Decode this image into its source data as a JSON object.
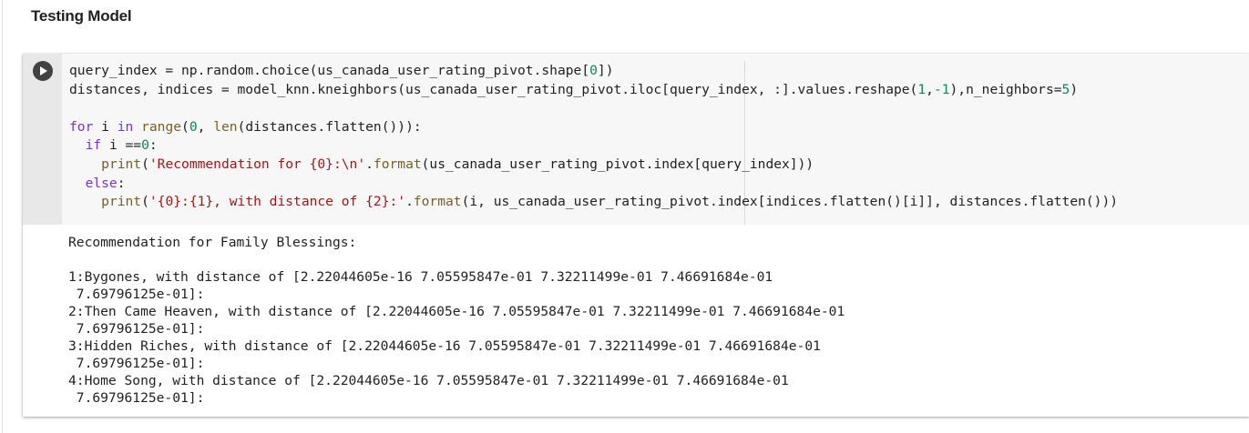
{
  "section": {
    "heading": "Testing Model"
  },
  "cell": {
    "run_icon": "play-icon",
    "code_lines": [
      [
        {
          "t": "query_index = np.random.choice(us_canada_user_rating_pivot.shape[",
          "c": ""
        },
        {
          "t": "0",
          "c": "num"
        },
        {
          "t": "])",
          "c": ""
        }
      ],
      [
        {
          "t": "distances, indices = model_knn.kneighbors(us_canada_user_rating_pivot.iloc[query_index, :].values.reshape(",
          "c": ""
        },
        {
          "t": "1",
          "c": "num"
        },
        {
          "t": ",",
          "c": ""
        },
        {
          "t": "-1",
          "c": "num"
        },
        {
          "t": "),n_neighbors=",
          "c": ""
        },
        {
          "t": "5",
          "c": "num"
        },
        {
          "t": ")",
          "c": ""
        }
      ],
      [],
      [
        {
          "t": "for",
          "c": "kw"
        },
        {
          "t": " i ",
          "c": ""
        },
        {
          "t": "in",
          "c": "kw"
        },
        {
          "t": " ",
          "c": ""
        },
        {
          "t": "range",
          "c": "bi"
        },
        {
          "t": "(",
          "c": ""
        },
        {
          "t": "0",
          "c": "num"
        },
        {
          "t": ", ",
          "c": ""
        },
        {
          "t": "len",
          "c": "bi"
        },
        {
          "t": "(distances.flatten())):",
          "c": ""
        }
      ],
      [
        {
          "t": "  ",
          "c": ""
        },
        {
          "t": "if",
          "c": "kw"
        },
        {
          "t": " i ==",
          "c": ""
        },
        {
          "t": "0",
          "c": "num"
        },
        {
          "t": ":",
          "c": ""
        }
      ],
      [
        {
          "t": "    ",
          "c": ""
        },
        {
          "t": "print",
          "c": "bi"
        },
        {
          "t": "(",
          "c": ""
        },
        {
          "t": "'Recommendation for {0}:\\n'",
          "c": "str"
        },
        {
          "t": ".",
          "c": ""
        },
        {
          "t": "format",
          "c": "bi"
        },
        {
          "t": "(us_canada_user_rating_pivot.index[query_index]))",
          "c": ""
        }
      ],
      [
        {
          "t": "  ",
          "c": ""
        },
        {
          "t": "else",
          "c": "kw"
        },
        {
          "t": ":",
          "c": ""
        }
      ],
      [
        {
          "t": "    ",
          "c": ""
        },
        {
          "t": "print",
          "c": "bi"
        },
        {
          "t": "(",
          "c": ""
        },
        {
          "t": "'{0}:{1}, with distance of {2}:'",
          "c": "str"
        },
        {
          "t": ".",
          "c": ""
        },
        {
          "t": "format",
          "c": "bi"
        },
        {
          "t": "(i, us_canada_user_rating_pivot.index[indices.flatten()[i]], distances.flatten()))",
          "c": ""
        }
      ]
    ],
    "output_lines": [
      "Recommendation for Family Blessings:",
      "",
      "1:Bygones, with distance of [2.22044605e-16 7.05595847e-01 7.32211499e-01 7.46691684e-01",
      " 7.69796125e-01]:",
      "2:Then Came Heaven, with distance of [2.22044605e-16 7.05595847e-01 7.32211499e-01 7.46691684e-01",
      " 7.69796125e-01]:",
      "3:Hidden Riches, with distance of [2.22044605e-16 7.05595847e-01 7.32211499e-01 7.46691684e-01",
      " 7.69796125e-01]:",
      "4:Home Song, with distance of [2.22044605e-16 7.05595847e-01 7.32211499e-01 7.46691684e-01",
      " 7.69796125e-01]:"
    ]
  },
  "colors": {
    "keyword": "#7b30d0",
    "builtin": "#795e26",
    "number": "#09885a",
    "string": "#a31515",
    "code_background": "#f7f7f7",
    "gutter": "#e8e8e8"
  }
}
